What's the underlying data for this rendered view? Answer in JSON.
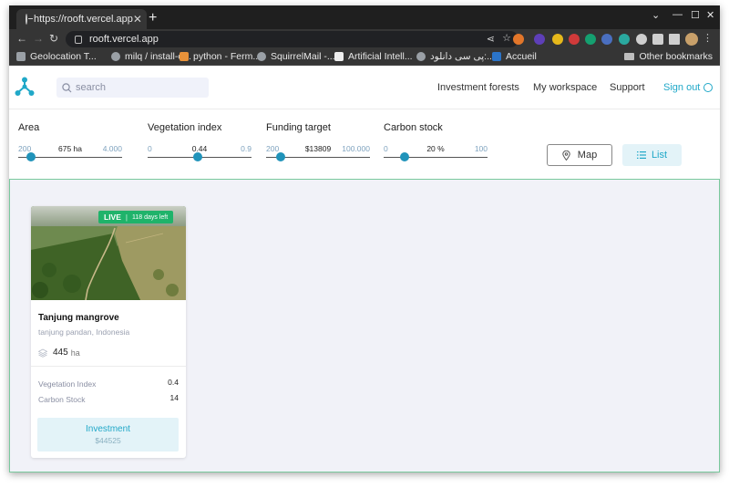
{
  "browser": {
    "tab_title": "https://rooft.vercel.app",
    "address": "rooft.vercel.app",
    "bookmarks": [
      {
        "label": "Geolocation T..."
      },
      {
        "label": "milq / install-o..."
      },
      {
        "label": "python - Ferm..."
      },
      {
        "label": "SquirrelMail -..."
      },
      {
        "label": "Artificial Intell..."
      },
      {
        "label": "پی سی دانلود:..."
      },
      {
        "label": "Accueil"
      }
    ],
    "other_bookmarks": "Other bookmarks"
  },
  "header": {
    "search_placeholder": "search",
    "nav": [
      "Investment forests",
      "My workspace",
      "Support"
    ],
    "signout": "Sign out"
  },
  "filters": [
    {
      "label": "Area",
      "min": "200",
      "value": "675 ha",
      "max": "4.000",
      "fraction": 0.12
    },
    {
      "label": "Vegetation index",
      "min": "0",
      "value": "0.44",
      "max": "0.9",
      "fraction": 0.48
    },
    {
      "label": "Funding target",
      "min": "200",
      "value": "$13809",
      "max": "100.000",
      "fraction": 0.14
    },
    {
      "label": "Carbon stock",
      "min": "0",
      "value": "20 %",
      "max": "100",
      "fraction": 0.2
    }
  ],
  "view_toggle": {
    "map": "Map",
    "list": "List",
    "active": "list"
  },
  "cards": [
    {
      "status": "LIVE",
      "days_left": "118 days left",
      "title": "Tanjung mangrove",
      "location": "tanjung pandan, Indonesia",
      "area": "445",
      "area_unit": "ha",
      "metrics": [
        {
          "label": "Vegetation Index",
          "value": "0.4"
        },
        {
          "label": "Carbon Stock",
          "value": "14"
        }
      ],
      "cta": "Investment",
      "amount": "$44525"
    }
  ],
  "colors": {
    "accent": "#20a8c8",
    "live": "#1fb36a",
    "slider": "#2093ba",
    "content_bg": "#f1f2f8"
  }
}
